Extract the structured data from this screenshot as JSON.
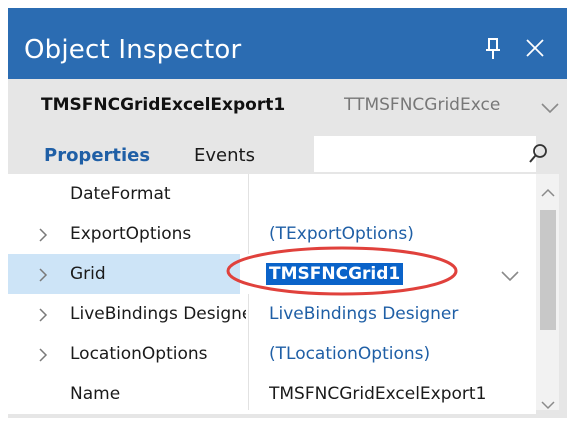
{
  "window": {
    "title": "Object Inspector",
    "pin_icon": "pin-icon",
    "close_icon": "close-icon"
  },
  "object_selector": {
    "name": "TMSFNCGridExcelExport1",
    "type": "TTMSFNCGridExce",
    "dropdown_icon": "chevron-down-icon"
  },
  "tabs": {
    "properties": "Properties",
    "events": "Events"
  },
  "search": {
    "icon": "search-icon"
  },
  "properties": [
    {
      "name": "DateFormat",
      "value": "",
      "expandable": false,
      "selected": false
    },
    {
      "name": "ExportOptions",
      "value": "(TExportOptions)",
      "expandable": true,
      "selected": false
    },
    {
      "name": "Grid",
      "value": "TMSFNCGrid1",
      "expandable": true,
      "selected": true
    },
    {
      "name": "LiveBindings Designer",
      "value": "LiveBindings Designer",
      "expandable": true,
      "selected": false
    },
    {
      "name": "LocationOptions",
      "value": "(TLocationOptions)",
      "expandable": true,
      "selected": false
    },
    {
      "name": "Name",
      "value": "TMSFNCGridExcelExport1",
      "expandable": false,
      "selected": false
    }
  ],
  "colors": {
    "title_bar": "#2b6cb2",
    "selection": "#cde4f7",
    "value_text": "#1f5fa6",
    "annotation": "#e0413c"
  }
}
